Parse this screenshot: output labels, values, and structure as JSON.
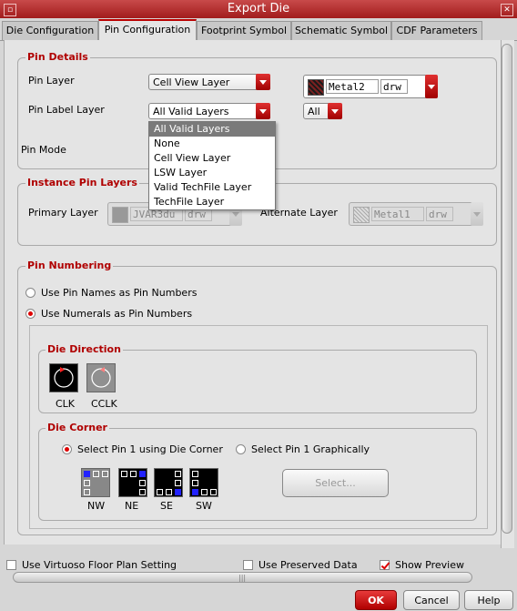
{
  "window": {
    "title": "Export Die"
  },
  "tabs": [
    {
      "label": "Die Configuration"
    },
    {
      "label": "Pin Configuration"
    },
    {
      "label": "Footprint Symbol"
    },
    {
      "label": "Schematic Symbol"
    },
    {
      "label": "CDF Parameters"
    }
  ],
  "pin_details": {
    "legend": "Pin Details",
    "pin_layer_label": "Pin Layer",
    "pin_layer_value": "Cell View Layer",
    "layer_name": "Metal2",
    "layer_purpose": "drw",
    "pin_label_layer_label": "Pin Label Layer",
    "pin_label_layer_value": "All Valid Layers",
    "all_value": "All",
    "pin_mode_label": "Pin Mode",
    "dropdown_options": [
      "All Valid Layers",
      "None",
      "Cell View Layer",
      "LSW Layer",
      "Valid TechFile Layer",
      "TechFile Layer"
    ]
  },
  "instance_pin_layers": {
    "legend": "Instance Pin Layers",
    "primary_label": "Primary Layer",
    "primary_name": "JVAR3du",
    "primary_purpose": "drw",
    "alternate_label": "Alternate Layer",
    "alternate_name": "Metal1",
    "alternate_purpose": "drw"
  },
  "pin_numbering": {
    "legend": "Pin Numbering",
    "option_names": "Use Pin Names as Pin Numbers",
    "option_numerals": "Use Numerals as Pin Numbers",
    "die_direction": {
      "legend": "Die Direction",
      "clk": "CLK",
      "cclk": "CCLK"
    },
    "die_corner": {
      "legend": "Die Corner",
      "option_corner": "Select Pin 1 using Die Corner",
      "option_graphical": "Select Pin 1 Graphically",
      "select_button": "Select...",
      "corners": [
        "NW",
        "NE",
        "SE",
        "SW"
      ]
    }
  },
  "bottom": {
    "floorplan": "Use Virtuoso Floor Plan Setting",
    "preserved": "Use Preserved Data",
    "preview": "Show Preview",
    "ok": "OK",
    "cancel": "Cancel",
    "help": "Help"
  },
  "colors": {
    "accent": "#b00000",
    "highlight_blue": "#2222ff"
  }
}
